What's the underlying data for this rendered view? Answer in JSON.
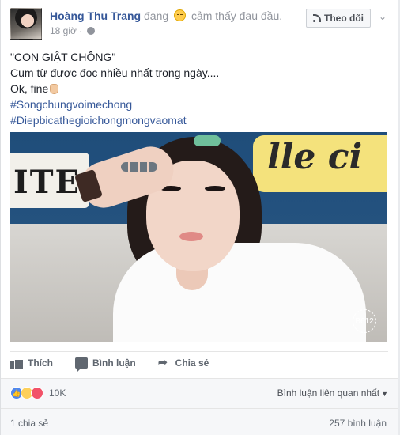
{
  "post": {
    "author": "Hoàng Thu Trang",
    "feeling_prefix": "đang",
    "feeling_text": "cảm thấy đau đầu.",
    "time": "18 giờ",
    "follow_label": "Theo dõi",
    "privacy_icon": "globe-icon",
    "lines": [
      "\"CON GIẬT CHỒNG\"",
      "Cụm từ được đọc nhiều nhất trong ngày....",
      "Ok, fine",
      "#Songchungvoimechong",
      "#Diepbicathegioichongmongvaomat"
    ],
    "photo": {
      "sign_left_text": "ITE",
      "sign_right_text": "lle ci",
      "watermark": "B612"
    }
  },
  "actions": {
    "like": "Thích",
    "comment": "Bình luận",
    "share": "Chia sẻ"
  },
  "reactions": {
    "types": [
      "like",
      "haha",
      "love"
    ],
    "count": "10K",
    "sort_label": "Bình luận liên quan nhất"
  },
  "footer": {
    "shares": "1 chia sẻ",
    "comments": "257 bình luận"
  },
  "colors": {
    "link": "#365899",
    "muted": "#90949c",
    "like_blue": "#4f87ee",
    "love_red": "#f25268",
    "haha_yellow": "#fdd05b"
  }
}
